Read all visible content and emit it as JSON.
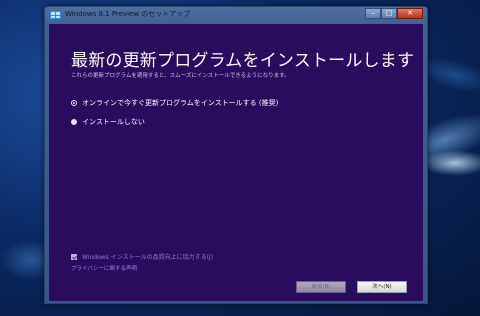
{
  "window": {
    "title": "Windows 8.1 Preview のセットアップ",
    "minimize_label": "–",
    "maximize_label": "□",
    "close_label": "✕"
  },
  "content": {
    "heading": "最新の更新プログラムをインストールします",
    "subheading": "これらの更新プログラムを適用すると、スムーズにインストールできるようになります。",
    "options": [
      {
        "label": "オンラインで今すぐ更新プログラムをインストールする (推奨)",
        "selected": true
      },
      {
        "label": "インストールしない",
        "selected": false
      }
    ],
    "feedback_checkbox": {
      "label": "Windows インストールの品質向上に協力する(J)",
      "checked": true
    },
    "privacy_link": "プライバシーに関する声明"
  },
  "buttons": {
    "back_label": "戻る(B)",
    "next_label": "次へ(N)"
  },
  "colors": {
    "client_background": "#2a0c5e",
    "window_frame": "#3f5f93",
    "desktop": "#0b2a66"
  }
}
